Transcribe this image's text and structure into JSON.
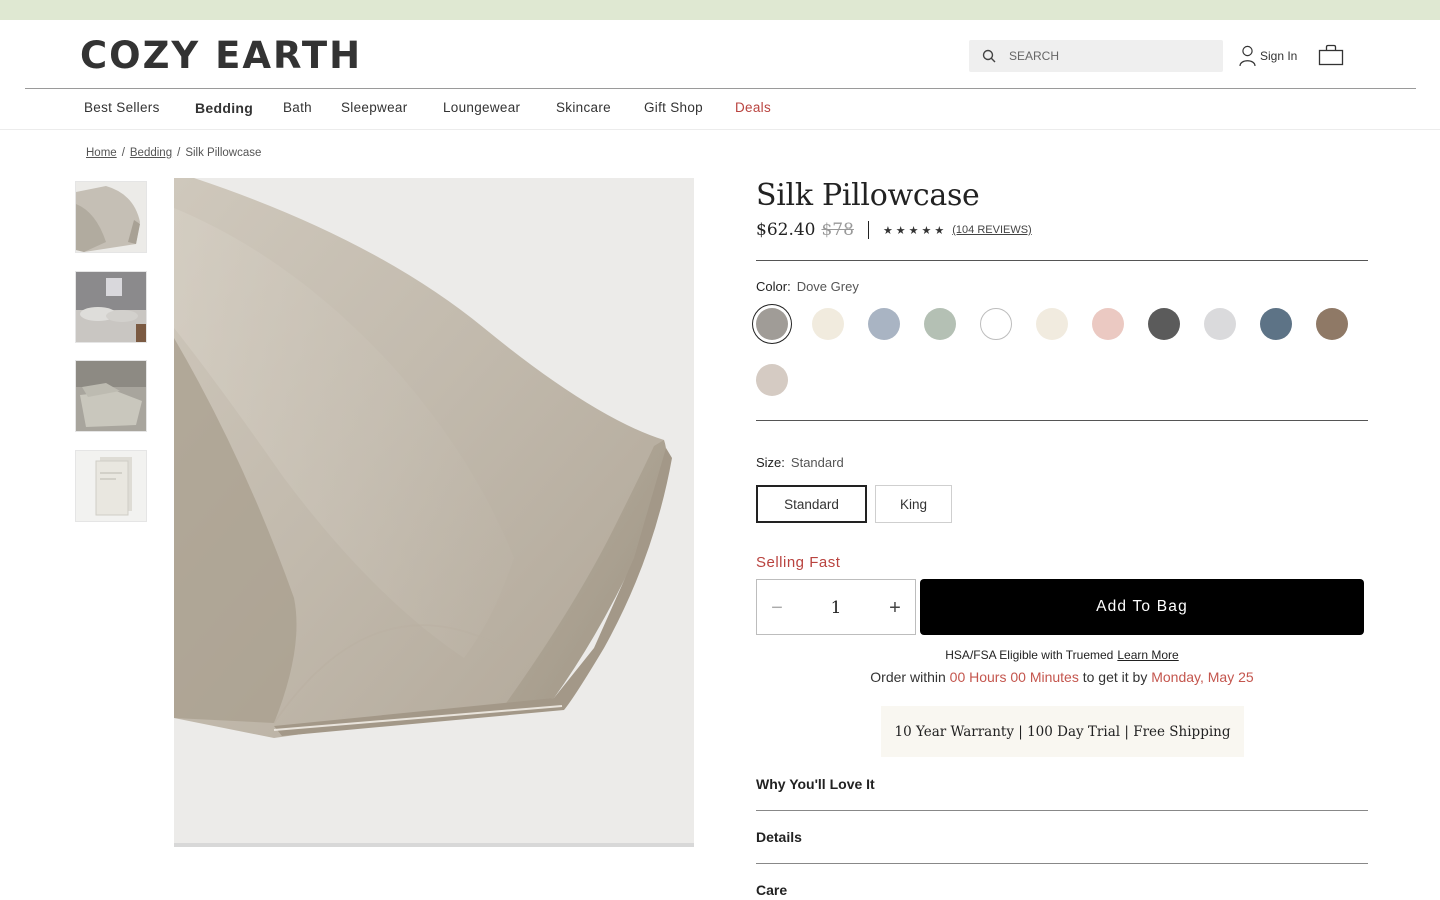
{
  "header": {
    "logo": "COZY EARTH",
    "search": {
      "placeholder": "SEARCH"
    },
    "signin_label": "Sign In"
  },
  "nav": {
    "items": [
      {
        "label": "Best Sellers"
      },
      {
        "label": "Bedding"
      },
      {
        "label": "Bath"
      },
      {
        "label": "Sleepwear"
      },
      {
        "label": "Loungewear"
      },
      {
        "label": "Skincare"
      },
      {
        "label": "Gift Shop"
      },
      {
        "label": "Deals"
      }
    ],
    "active": "Bedding"
  },
  "breadcrumb": {
    "home": "Home",
    "separator": "/",
    "category": "Bedding",
    "current": "Silk Pillowcase"
  },
  "product": {
    "title": "Silk Pillowcase",
    "price": "$62.40",
    "compare_price": "$78",
    "stars": "★★★★★",
    "reviews": "(104 REVIEWS)",
    "color_label": "Color:",
    "color_value": "Dove Grey",
    "swatches": [
      {
        "name": "Dove Grey",
        "color": "#a09c97",
        "selected": true
      },
      {
        "name": "Cream",
        "color": "#f1ebde"
      },
      {
        "name": "Light Blue",
        "color": "#a9b4c3"
      },
      {
        "name": "Sage",
        "color": "#b4c0b4"
      },
      {
        "name": "White",
        "color": "#ffffff"
      },
      {
        "name": "Ivory",
        "color": "#f1ebdf"
      },
      {
        "name": "Blush",
        "color": "#ebc9c2"
      },
      {
        "name": "Charcoal",
        "color": "#5b5b5b"
      },
      {
        "name": "Light Grey",
        "color": "#dadadc"
      },
      {
        "name": "Slate Blue",
        "color": "#5d7386"
      },
      {
        "name": "Taupe",
        "color": "#8f7966"
      },
      {
        "name": "Sand",
        "color": "#d5cbc3"
      }
    ],
    "size_label": "Size:",
    "size_value": "Standard",
    "sizes": [
      {
        "label": "Standard",
        "selected": true
      },
      {
        "label": "King"
      }
    ],
    "selling_fast": "Selling Fast",
    "quantity": "1",
    "add_to_bag": "Add To Bag",
    "hsa_text": "HSA/FSA Eligible with Truemed",
    "hsa_link": "Learn More",
    "order_within_prefix": "Order within",
    "order_within_time": "00 Hours 00 Minutes",
    "order_within_middle": "to get it by",
    "order_within_date": "Monday, May 25",
    "warranty": "10 Year Warranty | 100 Day Trial | Free Shipping",
    "accordions": [
      {
        "label": "Why You'll Love It"
      },
      {
        "label": "Details"
      },
      {
        "label": "Care"
      }
    ]
  },
  "colors": {
    "promo_bar": "#dfe8d2",
    "accent_red": "#b9433f",
    "button_black": "#000000",
    "warranty_bg": "#f9f7f1"
  }
}
